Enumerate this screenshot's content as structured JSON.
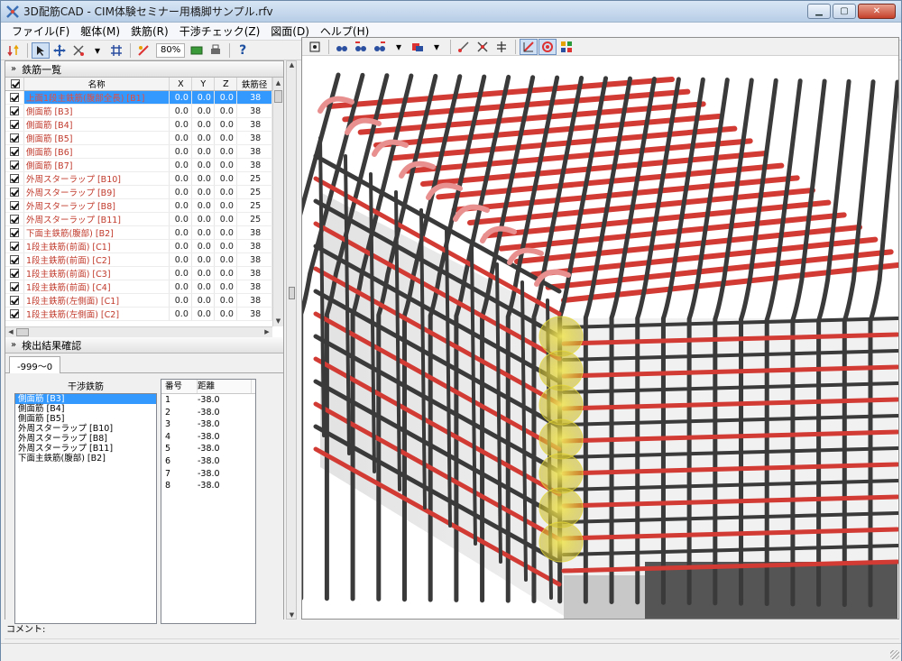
{
  "window": {
    "title": "3D配筋CAD - CIM体験セミナー用橋脚サンプル.rfv",
    "minimize_glyph": "▁",
    "maximize_glyph": "▢",
    "close_glyph": "✕"
  },
  "menu": [
    "ファイル(F)",
    "躯体(M)",
    "鉄筋(R)",
    "干渉チェック(Z)",
    "図面(D)",
    "ヘルプ(H)"
  ],
  "toolbar": {
    "zoom": "80%",
    "help_glyph": "?",
    "icons": [
      "sort-icon",
      "select-arrow-icon",
      "move-icon",
      "measure-icon",
      "grid-icon",
      "snap-icon",
      "view-icon",
      "print-icon",
      "help-icon"
    ]
  },
  "rebar_panel": {
    "title": "鉄筋一覧",
    "columns": [
      "名称",
      "X",
      "Y",
      "Z",
      "鉄筋径"
    ],
    "rows": [
      {
        "name": "上面1段主鉄筋(腹部全長) [B1]",
        "x": "0.0",
        "y": "0.0",
        "z": "0.0",
        "d": "38"
      },
      {
        "name": "側面筋 [B3]",
        "x": "0.0",
        "y": "0.0",
        "z": "0.0",
        "d": "38"
      },
      {
        "name": "側面筋 [B4]",
        "x": "0.0",
        "y": "0.0",
        "z": "0.0",
        "d": "38"
      },
      {
        "name": "側面筋 [B5]",
        "x": "0.0",
        "y": "0.0",
        "z": "0.0",
        "d": "38"
      },
      {
        "name": "側面筋 [B6]",
        "x": "0.0",
        "y": "0.0",
        "z": "0.0",
        "d": "38"
      },
      {
        "name": "側面筋 [B7]",
        "x": "0.0",
        "y": "0.0",
        "z": "0.0",
        "d": "38"
      },
      {
        "name": "外周スターラップ [B10]",
        "x": "0.0",
        "y": "0.0",
        "z": "0.0",
        "d": "25"
      },
      {
        "name": "外周スターラップ [B9]",
        "x": "0.0",
        "y": "0.0",
        "z": "0.0",
        "d": "25"
      },
      {
        "name": "外周スターラップ [B8]",
        "x": "0.0",
        "y": "0.0",
        "z": "0.0",
        "d": "25"
      },
      {
        "name": "外周スターラップ [B11]",
        "x": "0.0",
        "y": "0.0",
        "z": "0.0",
        "d": "25"
      },
      {
        "name": "下面主鉄筋(腹部) [B2]",
        "x": "0.0",
        "y": "0.0",
        "z": "0.0",
        "d": "38"
      },
      {
        "name": "1段主鉄筋(前面) [C1]",
        "x": "0.0",
        "y": "0.0",
        "z": "0.0",
        "d": "38"
      },
      {
        "name": "1段主鉄筋(前面) [C2]",
        "x": "0.0",
        "y": "0.0",
        "z": "0.0",
        "d": "38"
      },
      {
        "name": "1段主鉄筋(前面) [C3]",
        "x": "0.0",
        "y": "0.0",
        "z": "0.0",
        "d": "38"
      },
      {
        "name": "1段主鉄筋(前面) [C4]",
        "x": "0.0",
        "y": "0.0",
        "z": "0.0",
        "d": "38"
      },
      {
        "name": "1段主鉄筋(左側面) [C1]",
        "x": "0.0",
        "y": "0.0",
        "z": "0.0",
        "d": "38"
      },
      {
        "name": "1段主鉄筋(左側面) [C2]",
        "x": "0.0",
        "y": "0.0",
        "z": "0.0",
        "d": "38"
      }
    ]
  },
  "result_panel": {
    "title": "検出結果確認",
    "tab": "-999～0",
    "interference_header": "干渉鉄筋",
    "interference_items": [
      "側面筋 [B3]",
      "側面筋 [B4]",
      "側面筋 [B5]",
      "外周スターラップ [B10]",
      "外周スターラップ [B8]",
      "外周スターラップ [B11]",
      "下面主鉄筋(腹部) [B2]"
    ],
    "dist_columns": [
      "番号",
      "距離"
    ],
    "dist_rows": [
      {
        "n": "1",
        "d": "-38.0"
      },
      {
        "n": "2",
        "d": "-38.0"
      },
      {
        "n": "3",
        "d": "-38.0"
      },
      {
        "n": "4",
        "d": "-38.0"
      },
      {
        "n": "5",
        "d": "-38.0"
      },
      {
        "n": "6",
        "d": "-38.0"
      },
      {
        "n": "7",
        "d": "-38.0"
      },
      {
        "n": "8",
        "d": "-38.0"
      }
    ]
  },
  "comment_label": "コメント:",
  "colors": {
    "rebar_red": "#d23a34",
    "rebar_dark": "#3a3a3a",
    "interference_yellow": "#e6d93a",
    "selection": "#3399ff"
  }
}
